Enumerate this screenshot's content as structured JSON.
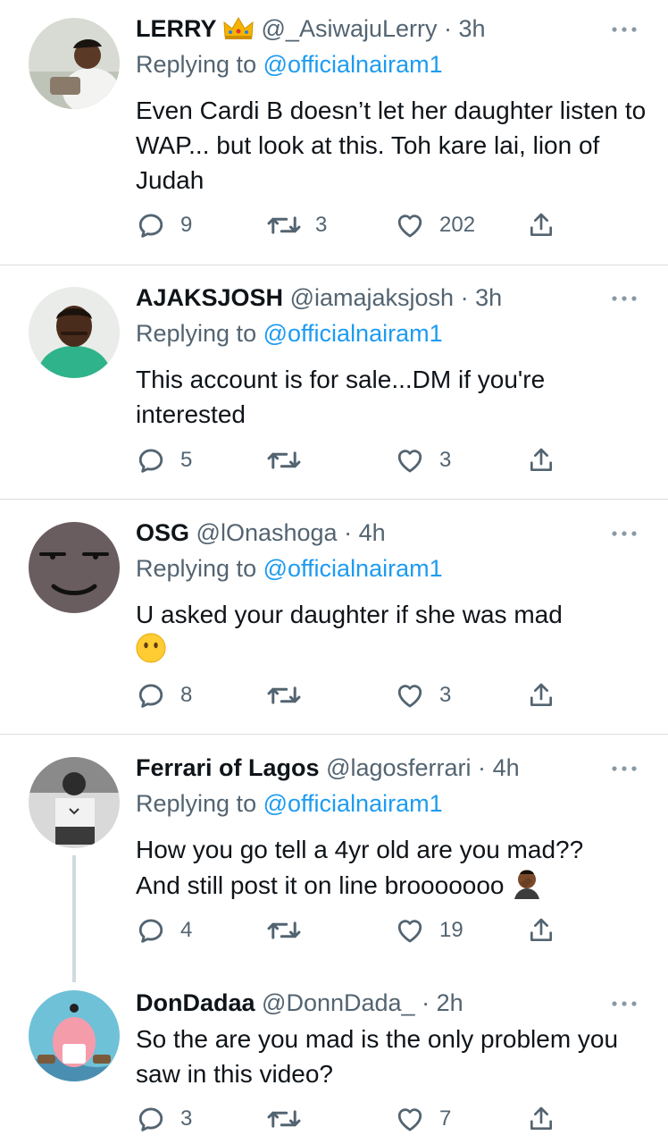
{
  "tweets": [
    {
      "name": "LERRY",
      "has_crown": true,
      "handle": "@_AsiwajuLerry",
      "separator": "·",
      "time": "3h",
      "replying_prefix": "Replying to",
      "replying_to": "@officialnairam1",
      "text": "Even Cardi B doesn’t let her daughter listen to WAP... but look at this. Toh kare lai, lion of Judah",
      "replies": "9",
      "retweets": "3",
      "likes": "202"
    },
    {
      "name": "AJAKSJOSH",
      "handle": "@iamajaksjosh",
      "separator": "·",
      "time": "3h",
      "replying_prefix": "Replying to",
      "replying_to": "@officialnairam1",
      "text": "This account is for sale...DM if you're interested",
      "replies": "5",
      "retweets": "",
      "likes": "3"
    },
    {
      "name": "OSG",
      "handle": "@lOnashoga",
      "separator": "·",
      "time": "4h",
      "replying_prefix": "Replying to",
      "replying_to": "@officialnairam1",
      "text": "U asked your daughter if she was mad",
      "emoji": "hushed-face-emoji",
      "replies": "8",
      "retweets": "",
      "likes": "3"
    },
    {
      "name": "Ferrari of Lagos",
      "handle": "@lagosferrari",
      "separator": "·",
      "time": "4h",
      "replying_prefix": "Replying to",
      "replying_to": "@officialnairam1",
      "text_line1": "How you go tell a 4yr old are you mad??",
      "text_line2": "And still post it on line brooooooo",
      "emoji": "facepalm-emoji",
      "replies": "4",
      "retweets": "",
      "likes": "19"
    },
    {
      "name": "DonDadaa",
      "handle": "@DonnDada_",
      "separator": "·",
      "time": "2h",
      "text": "So the are you mad is the only problem you saw in this video?",
      "replies": "3",
      "retweets": "",
      "likes": "7"
    }
  ],
  "icons": {
    "reply": "reply-icon",
    "retweet": "retweet-icon",
    "like": "heart-icon",
    "share": "share-icon",
    "more": "more-icon"
  },
  "colors": {
    "text": "#0f1419",
    "secondary": "#536471",
    "link": "#1d9bf0",
    "divider": "#dcdcdc",
    "thread_line": "#cfd9de"
  }
}
